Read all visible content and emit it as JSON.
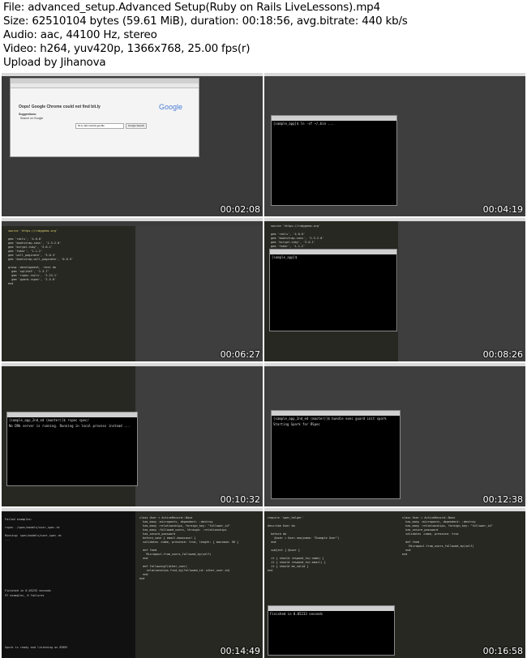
{
  "header": {
    "file": "File: advanced_setup.Advanced Setup(Ruby on Rails LiveLessons).mp4",
    "size": "Size: 62510104 bytes (59.61 MiB), duration: 00:18:56, avg.bitrate: 440 kb/s",
    "audio": "Audio: aac, 44100 Hz, stereo",
    "video": "Video: h264, yuv420p, 1366x768, 25.00 fps(r)",
    "upload": "Upload by Jihanova"
  },
  "thumbs": [
    {
      "time": "00:02:08"
    },
    {
      "time": "00:04:19"
    },
    {
      "time": "00:06:27"
    },
    {
      "time": "00:08:26"
    },
    {
      "time": "00:10:32"
    },
    {
      "time": "00:12:38"
    },
    {
      "time": "00:14:49"
    },
    {
      "time": "00:16:58"
    }
  ],
  "screens": {
    "chrome_error": {
      "title": "Oops! Google Chrome could not find bit.ly",
      "suggestions": "Suggestions:",
      "search_item": "Search on Google",
      "search_value": "bit.ly rails tutorial gemfile",
      "search_button": "Google Search",
      "logo": "Google"
    },
    "term1": "[sample_app]$ ln -sf ~/.bin ...",
    "term2": "[sample_app]$",
    "term3a": "[sample_app_2nd_ed (master)]$ rspec spec/",
    "term3b": "No DRb server is running. Running in local process instead ...",
    "term4": "[sample_app_2nd_ed (master)]$ bundle exec guard init spork",
    "term4b": "Starting Spork for RSpec",
    "spork": "Spork is ready and listening on 8989!",
    "finished": "Finished in 0.05233 seconds",
    "examples": "97 examples, 0 failures"
  }
}
